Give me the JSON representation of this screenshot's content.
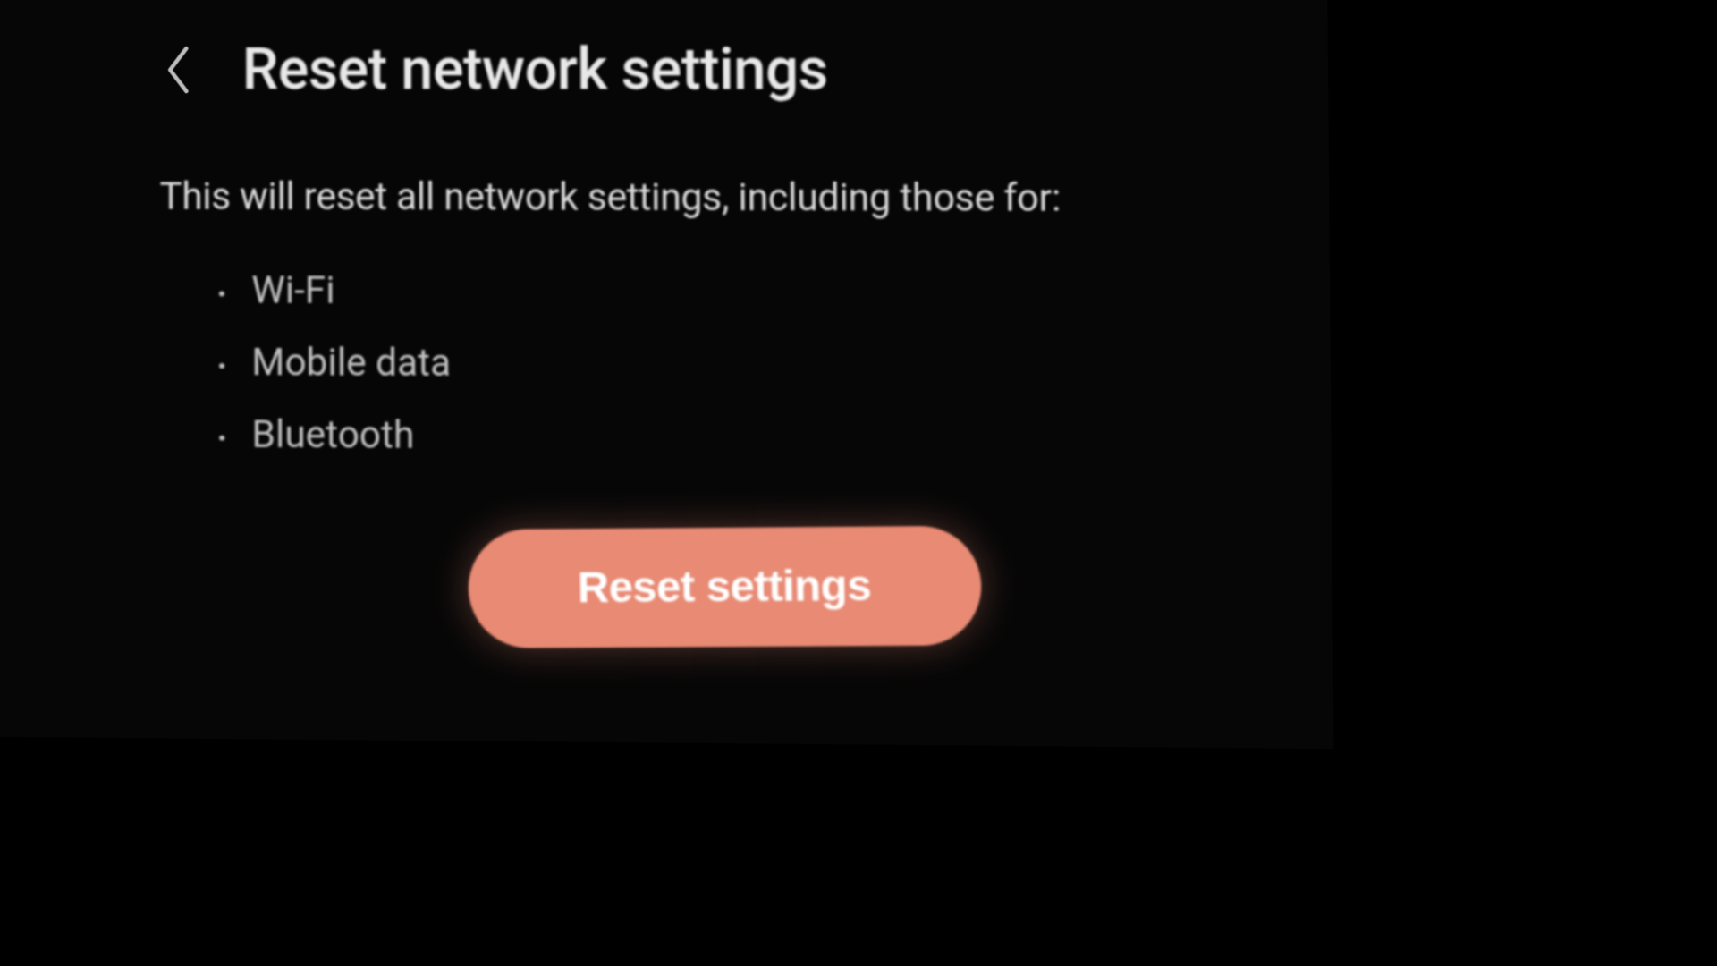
{
  "header": {
    "title": "Reset network settings"
  },
  "body": {
    "description": "This will reset all network settings, including those for:",
    "items": [
      "Wi-Fi",
      "Mobile data",
      "Bluetooth"
    ]
  },
  "actions": {
    "reset_label": "Reset settings"
  },
  "colors": {
    "accent": "#e88a74",
    "background": "#000000",
    "text_primary": "#e8e8e8",
    "text_secondary": "#bfbfbf"
  }
}
